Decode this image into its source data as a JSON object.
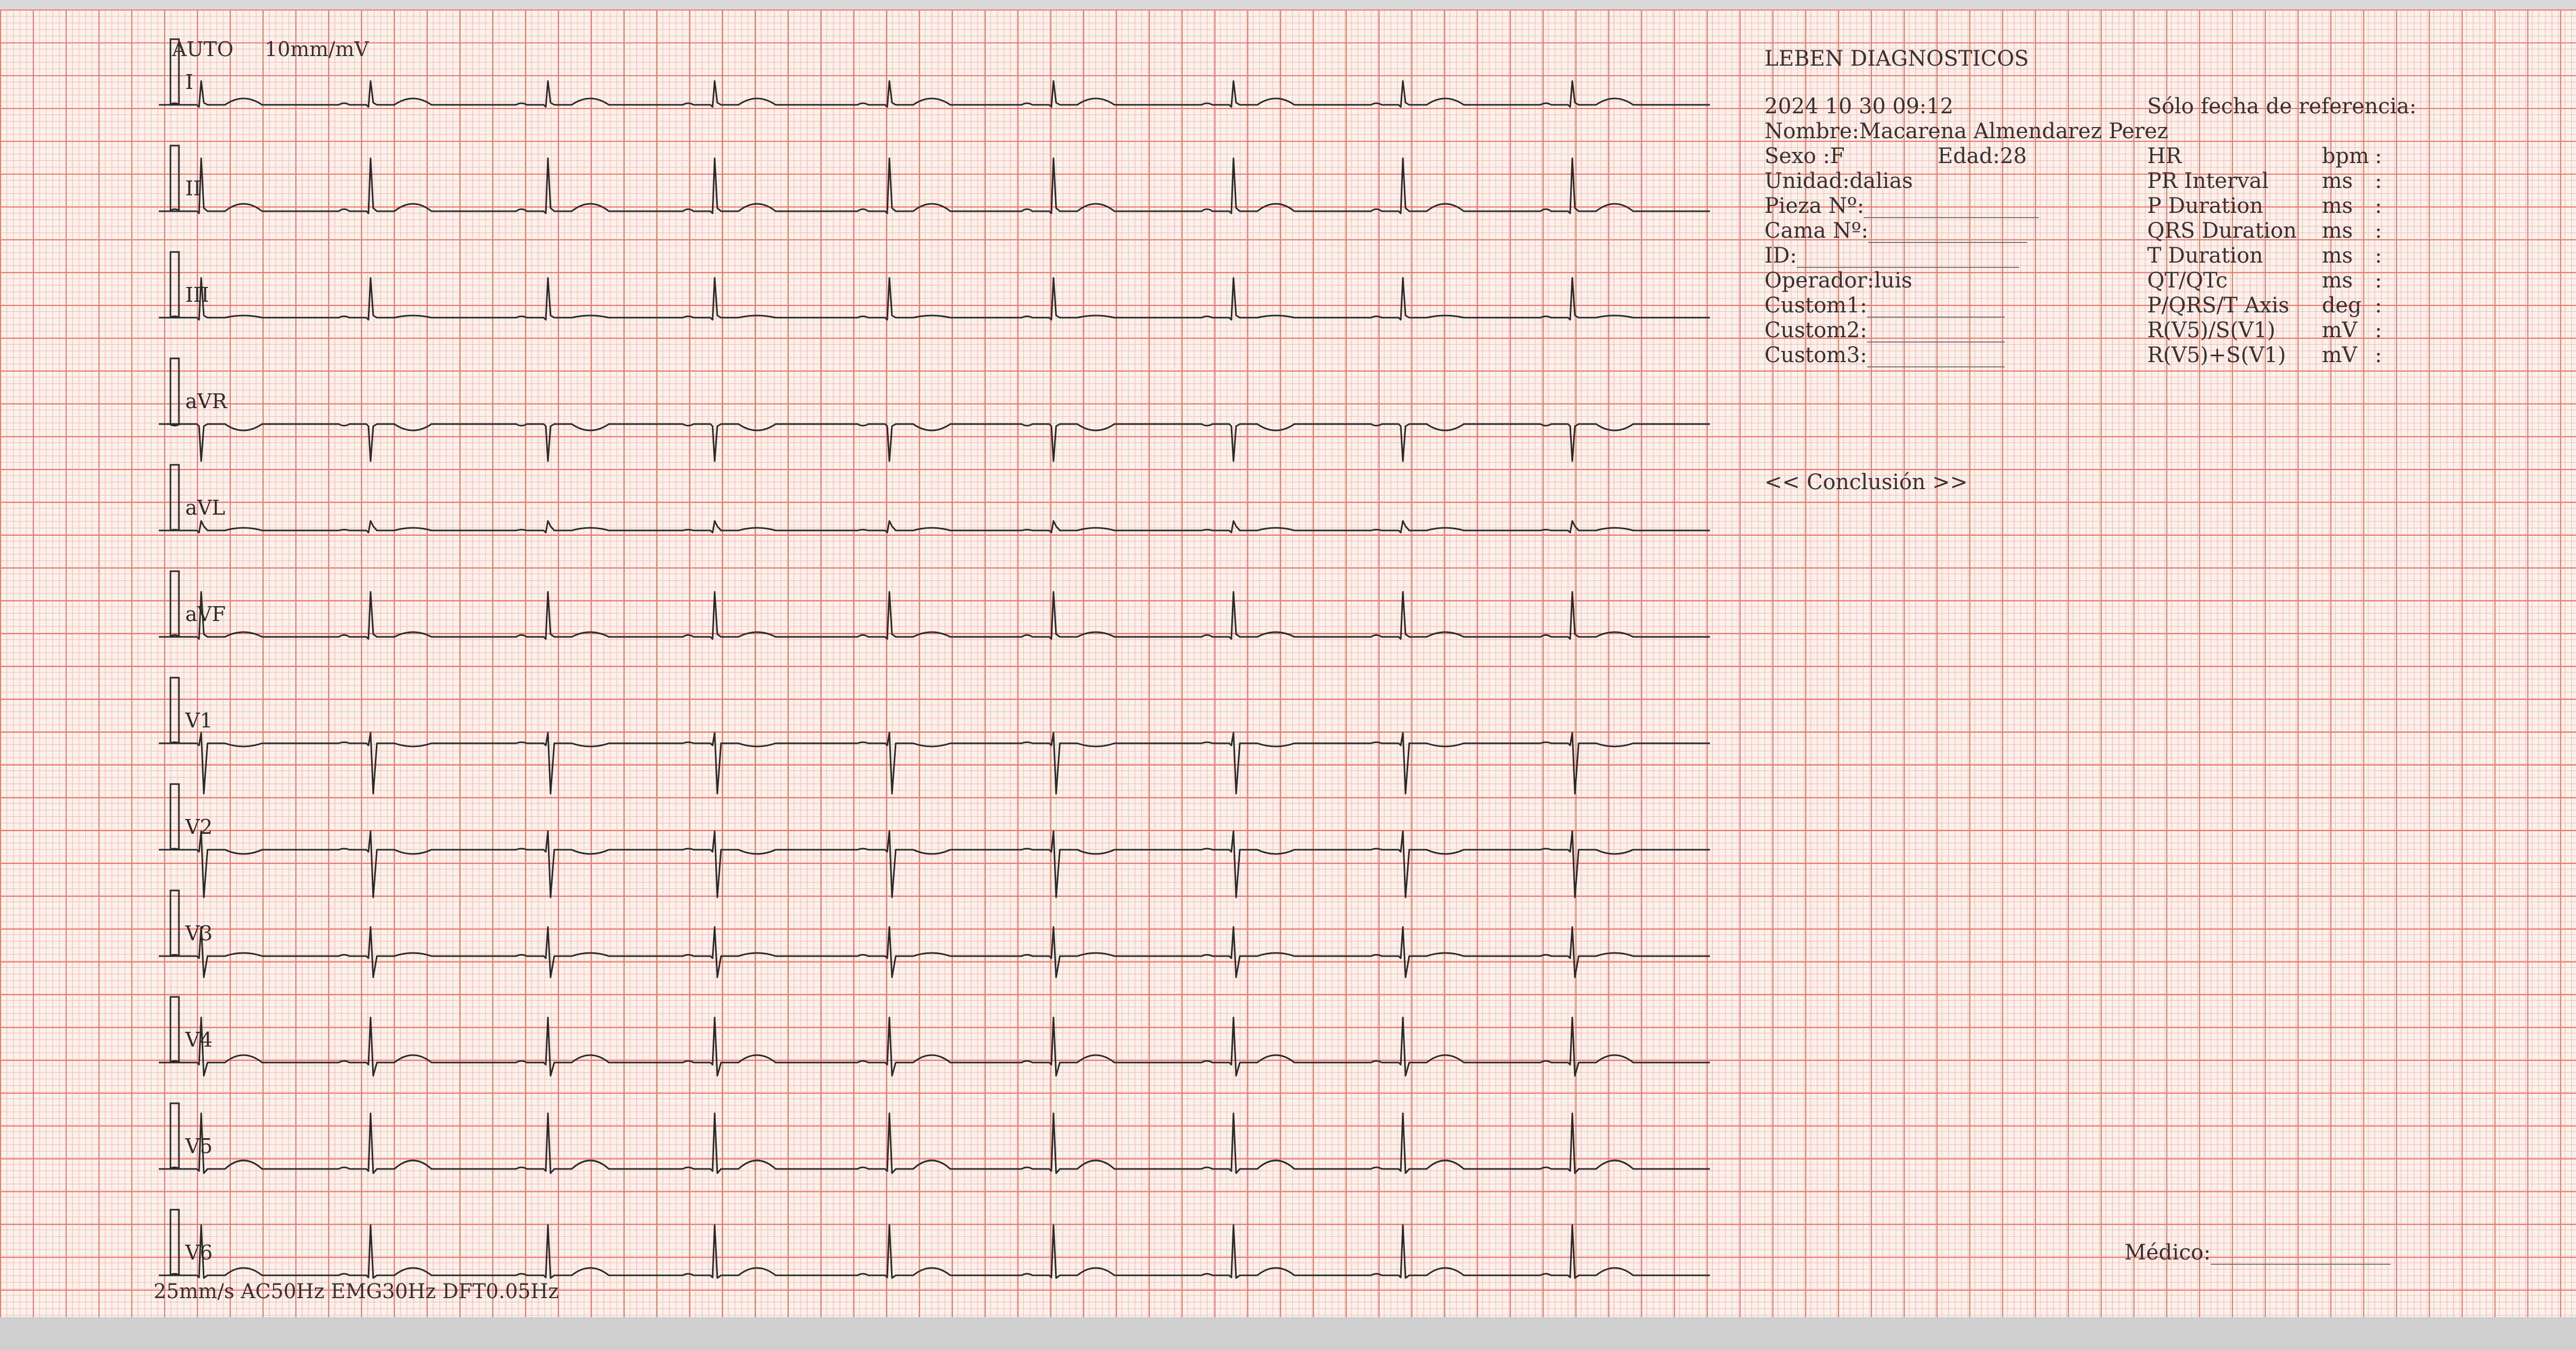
{
  "header": {
    "mode": "AUTO",
    "gain": "10mm/mV",
    "footer": "25mm/s  AC50Hz EMG30Hz DFT0.05Hz"
  },
  "leads": [
    "I",
    "II",
    "III",
    "aVR",
    "aVL",
    "aVF",
    "V1",
    "V2",
    "V3",
    "V4",
    "V5",
    "V6"
  ],
  "report": {
    "company": "LEBEN DIAGNOSTICOS",
    "datetime": "2024 10 30 09:12",
    "reference_note": "Sólo fecha de referencia:",
    "patient": {
      "nombre": "Nombre:Macarena Almendarez Perez",
      "sexo": "Sexo :F",
      "edad": "Edad:28",
      "unidad": "Unidad:dalias",
      "pieza": "Pieza Nº:",
      "cama": "Cama Nº:",
      "id": "ID:",
      "operador": "Operador:luis",
      "custom1": "Custom1:",
      "custom2": "Custom2:",
      "custom3": "Custom3:"
    },
    "measurements": [
      {
        "name": "HR",
        "unit": "bpm",
        "sep": ":"
      },
      {
        "name": "PR Interval",
        "unit": "ms",
        "sep": ":"
      },
      {
        "name": "P Duration",
        "unit": "ms",
        "sep": ":"
      },
      {
        "name": "QRS Duration",
        "unit": "ms",
        "sep": ":"
      },
      {
        "name": "T Duration",
        "unit": "ms",
        "sep": ":"
      },
      {
        "name": "QT/QTc",
        "unit": "ms",
        "sep": ":"
      },
      {
        "name": "P/QRS/T Axis",
        "unit": "deg",
        "sep": ":"
      },
      {
        "name": "R(V5)/S(V1)",
        "unit": "mV",
        "sep": ":"
      },
      {
        "name": "R(V5)+S(V1)",
        "unit": "mV",
        "sep": ":"
      }
    ],
    "conclusion": "<< Conclusión >>",
    "medico": "Médico:"
  },
  "colors": {
    "paper": "#fdf1ec",
    "grid_major": "#ea7a70",
    "grid_minor": "#f6b7ad",
    "trace": "#2a2a2a"
  }
}
